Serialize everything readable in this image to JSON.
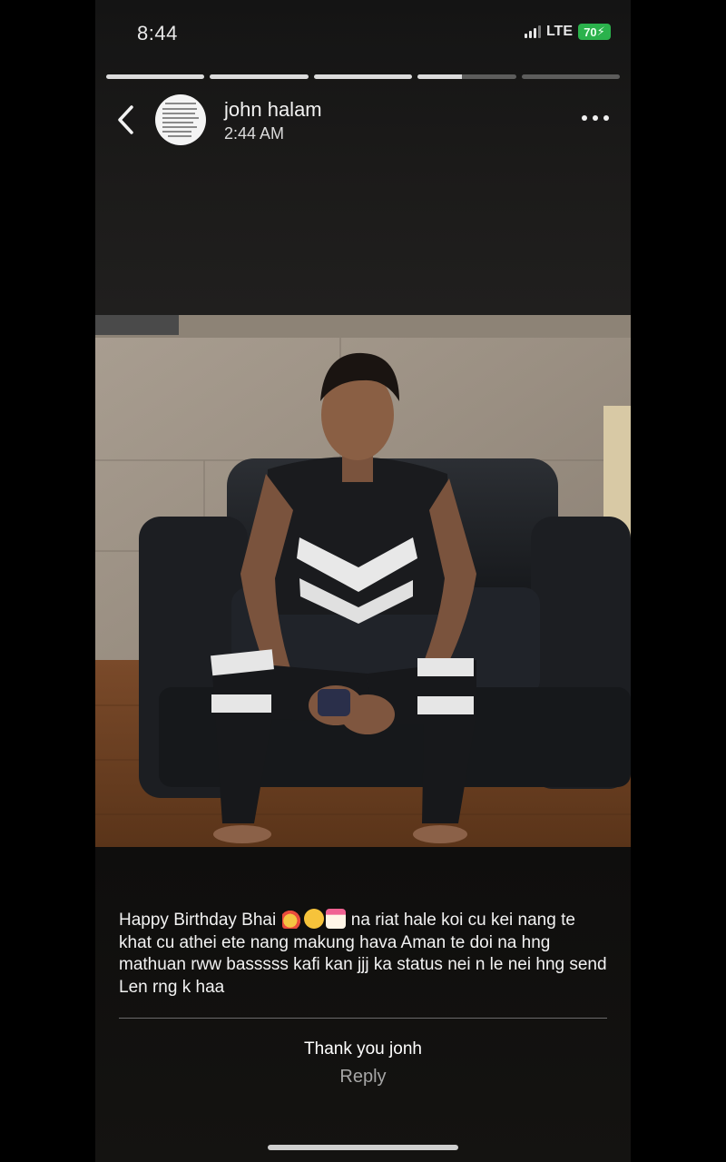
{
  "status_bar": {
    "time": "8:44",
    "network": "LTE",
    "battery": "70"
  },
  "story": {
    "segments_progress": [
      1,
      1,
      1,
      0.45,
      0
    ],
    "author": "john halam",
    "posted_time": "2:44 AM",
    "caption": "Happy Birthday Bhai 🎉🥳🎂 na riat hale koi cu kei nang te khat cu athei ete nang makung hava Aman te doi na hng mathuan rww basssss kafi kan jjj ka status nei n le nei hng send Len rng k haa",
    "caption_parts": {
      "before_emoji": "Happy Birthday Bhai",
      "after_emoji": "na riat hale koi cu kei nang te khat cu athei ete nang makung hava Aman te doi na hng mathuan rww basssss kafi kan jjj ka status nei n le nei hng send Len rng k haa"
    },
    "emojis": [
      "party-popper-icon",
      "partying-face-icon",
      "birthday-cake-icon"
    ],
    "reply_message": "Thank you jonh",
    "reply_label": "Reply"
  },
  "colors": {
    "battery": "#2bb24c",
    "background": "#000000"
  }
}
